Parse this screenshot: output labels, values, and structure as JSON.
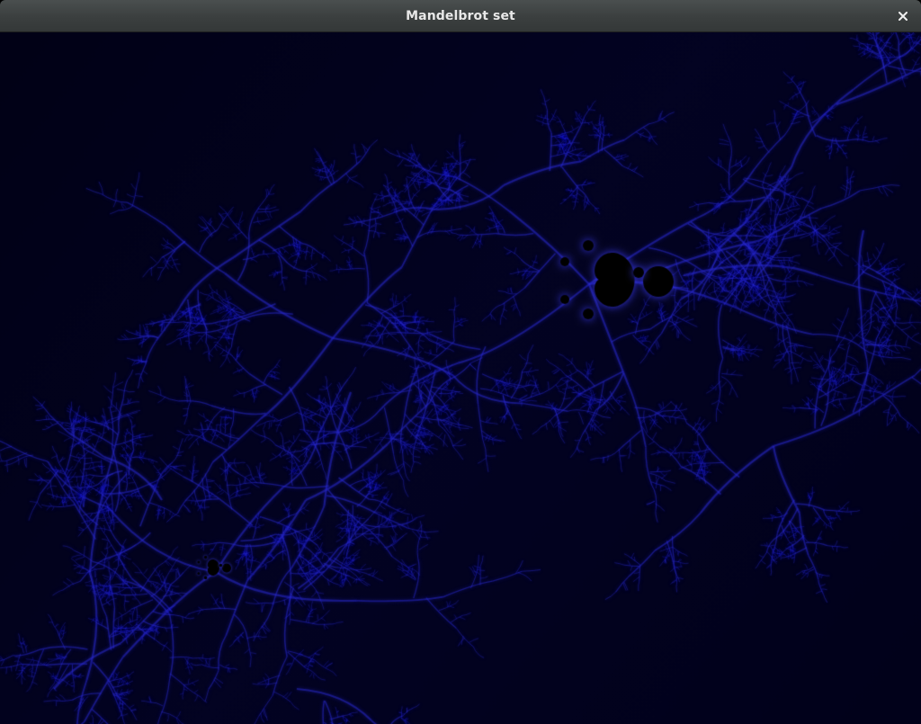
{
  "window": {
    "title": "Mandelbrot set",
    "close_icon": "close-icon"
  },
  "fractal": {
    "set_color": "#000000",
    "background_color": "#02021a",
    "filament_color": "#1a1aff"
  }
}
